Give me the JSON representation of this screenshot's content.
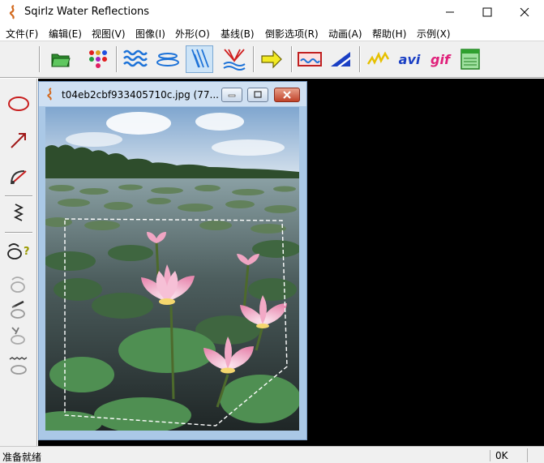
{
  "window": {
    "title": "Sqirlz Water Reflections",
    "minimize_icon": "minimize-icon",
    "maximize_icon": "maximize-icon",
    "close_icon": "close-icon"
  },
  "menu": [
    {
      "label": "文件(F)"
    },
    {
      "label": "编辑(E)"
    },
    {
      "label": "视图(V)"
    },
    {
      "label": "图像(I)"
    },
    {
      "label": "外形(O)"
    },
    {
      "label": "基线(B)"
    },
    {
      "label": "倒影选项(R)"
    },
    {
      "label": "动画(A)"
    },
    {
      "label": "帮助(H)"
    },
    {
      "label": "示例(X)"
    }
  ],
  "toolbar": {
    "open_icon": "folder-open-icon",
    "dots_icon": "colored-dots-icon",
    "waves_icon": "waves-icon",
    "ripples_icon": "ripples-icon",
    "rain_icon": "rain-icon",
    "splash_icon": "splash-icon",
    "arrow_icon": "arrow-right-icon",
    "frame_icon": "frame-icon",
    "perspective_icon": "perspective-icon",
    "sparkle_icon": "sparkle-icon",
    "avi_label": "avi",
    "gif_label": "gif",
    "window_icon": "green-window-icon",
    "active_tool": "rain"
  },
  "tools": [
    {
      "icon": "ellipse-icon"
    },
    {
      "icon": "arrow-diagonal-icon"
    },
    {
      "icon": "arc-tool-icon"
    },
    {
      "icon": "zigzag-icon"
    },
    {
      "icon": "shape-help-icon"
    },
    {
      "icon": "shape-wave-icon"
    },
    {
      "icon": "shape-pencil-icon"
    },
    {
      "icon": "shape-brush-icon"
    },
    {
      "icon": "shape-ripple-icon"
    }
  ],
  "document": {
    "title": "t04eb2cbf933405710c.jpg  (77...",
    "icon": "document-icon"
  },
  "status": {
    "left": "准备就绪",
    "right": "0K"
  }
}
